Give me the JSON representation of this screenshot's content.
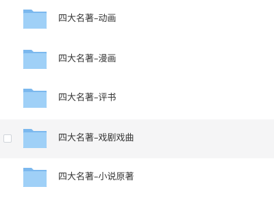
{
  "colors": {
    "folder_back": "#7bb8ee",
    "folder_front": "#9fd0f7",
    "text": "#333333",
    "hover_bg": "#f5f5f6"
  },
  "files": [
    {
      "name": "四大名著–动画",
      "icon": "folder-icon",
      "hovered": false
    },
    {
      "name": "四大名著–漫画",
      "icon": "folder-icon",
      "hovered": false
    },
    {
      "name": "四大名著–评书",
      "icon": "folder-icon",
      "hovered": false
    },
    {
      "name": "四大名著–戏剧戏曲",
      "icon": "folder-icon",
      "hovered": true,
      "checked": false
    },
    {
      "name": "四大名著–小说原著",
      "icon": "folder-icon",
      "hovered": false
    }
  ]
}
